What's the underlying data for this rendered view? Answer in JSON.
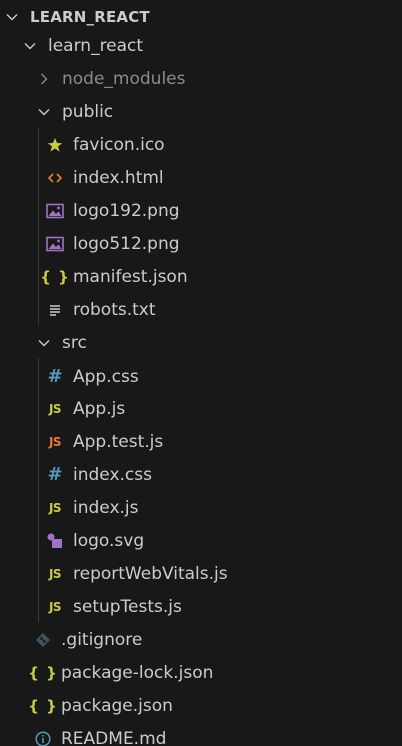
{
  "explorer": {
    "root_label": "LEARN_REACT",
    "folder_learn_react": "learn_react",
    "folder_node_modules": "node_modules",
    "folder_public": "public",
    "public_files": {
      "favicon": "favicon.ico",
      "index_html": "index.html",
      "logo192": "logo192.png",
      "logo512": "logo512.png",
      "manifest": "manifest.json",
      "robots": "robots.txt"
    },
    "folder_src": "src",
    "src_files": {
      "app_css": "App.css",
      "app_js": "App.js",
      "app_test": "App.test.js",
      "index_css": "index.css",
      "index_js": "index.js",
      "logo_svg": "logo.svg",
      "report": "reportWebVitals.js",
      "setup": "setupTests.js"
    },
    "root_files": {
      "gitignore": ".gitignore",
      "package_lock": "package-lock.json",
      "package": "package.json",
      "readme": "README.md"
    },
    "icons": {
      "js": "JS",
      "hash": "#",
      "braces": "{ }"
    }
  },
  "colors": {
    "background": "#181818",
    "text": "#cccccc",
    "text_dim": "#8b8b8b",
    "js_yellow": "#cbcb41",
    "js_test_orange": "#e37933",
    "css_blue": "#519aba",
    "html_orange": "#e37933",
    "image_purple": "#a074c4",
    "readme_blue": "#519aba"
  }
}
